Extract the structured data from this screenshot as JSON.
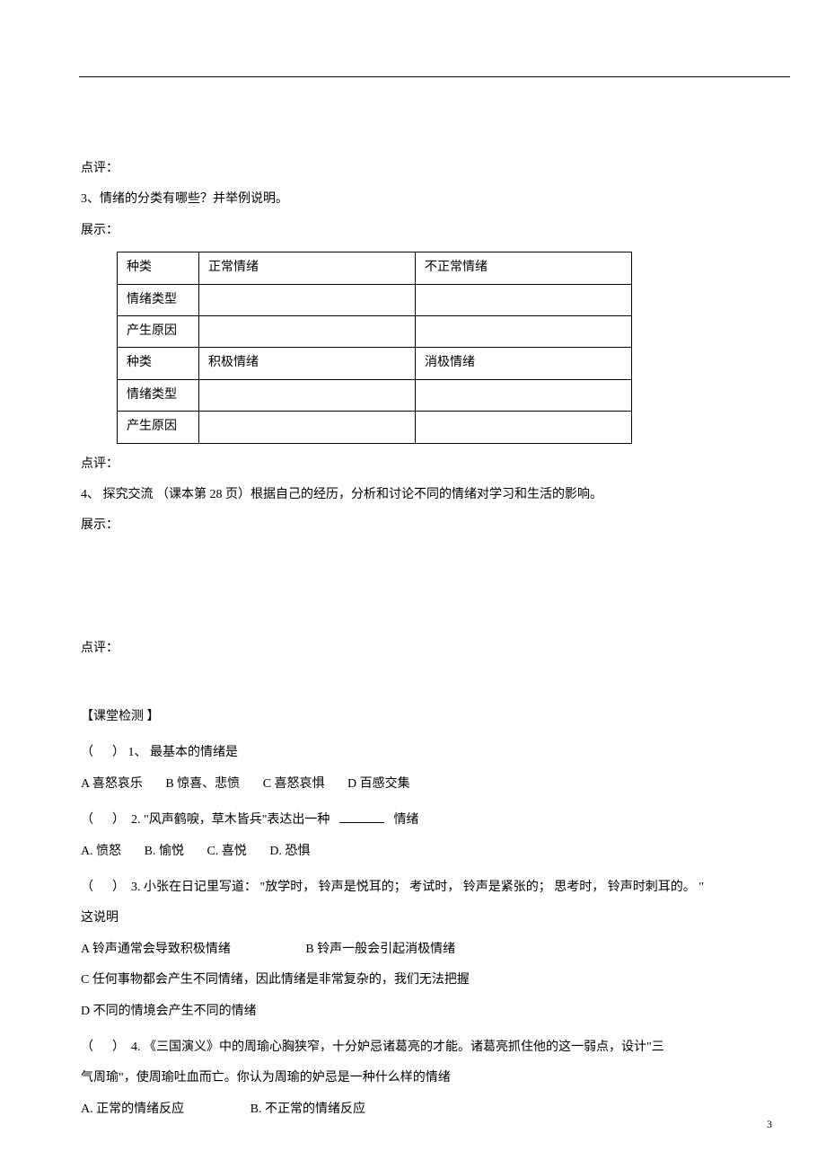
{
  "comment_label": "点评：",
  "display_label": "展示：",
  "q3": {
    "text": "3、情绪的分类有哪些？并举例说明。",
    "table": {
      "r1c1": "种类",
      "r1c2": "正常情绪",
      "r1c3": "不正常情绪",
      "r2c1": "情绪类型",
      "r3c1": "产生原因",
      "r4c1": "种类",
      "r4c2": "积极情绪",
      "r4c3": "消极情绪",
      "r5c1": "情绪类型",
      "r6c1": "产生原因"
    }
  },
  "q4": {
    "text": "4、 探究交流 （课本第  28 页）根据自己的经历，分析和讨论不同的情绪对学习和生活的影响。"
  },
  "section_header": "【课堂检测 】",
  "test": {
    "paren_open": "（",
    "paren_close": "）",
    "q1": {
      "num": "1、",
      "stem": "最基本的情绪是",
      "opts": {
        "A": "A 喜怒哀乐",
        "B": "B   惊喜、悲愤",
        "C": "C   喜怒哀惧",
        "D": "D   百感交集"
      }
    },
    "q2": {
      "num": "2.",
      "stem_pre": "\"风声鹤唳，草木皆兵\"表达出一种",
      "stem_post": "情绪",
      "opts": {
        "A": "A. 愤怒",
        "B": "B.   愉悦",
        "C": "C.   喜悦",
        "D": "D.   恐惧"
      }
    },
    "q3": {
      "num": "3.",
      "stem_l1": "小张在日记里写道： \"放学时， 铃声是悦耳的；  考试时， 铃声是紧张的；  思考时， 铃声时刺耳的。 \"",
      "stem_l2": "这说明",
      "opts": {
        "A": "A 铃声通常会导致积极情绪",
        "B": "B     铃声一般会引起消极情绪",
        "C": "C 任何事物都会产生不同情绪，因此情绪是非常复杂的，我们无法把握",
        "D": "D 不同的情境会产生不同的情绪"
      }
    },
    "q4": {
      "num": "4.",
      "stem_l1": "《三国演义》中的周瑜心胸狭窄，十分妒忌诸葛亮的才能。诸葛亮抓住他的这一弱点，设计\"三",
      "stem_l2": "气周瑜\"，使周瑜吐血而亡。你认为周瑜的妒忌是一种什么样的情绪",
      "opts": {
        "A": "A. 正常的情绪反应",
        "B": "B.     不正常的情绪反应"
      }
    }
  },
  "page_number": "3"
}
